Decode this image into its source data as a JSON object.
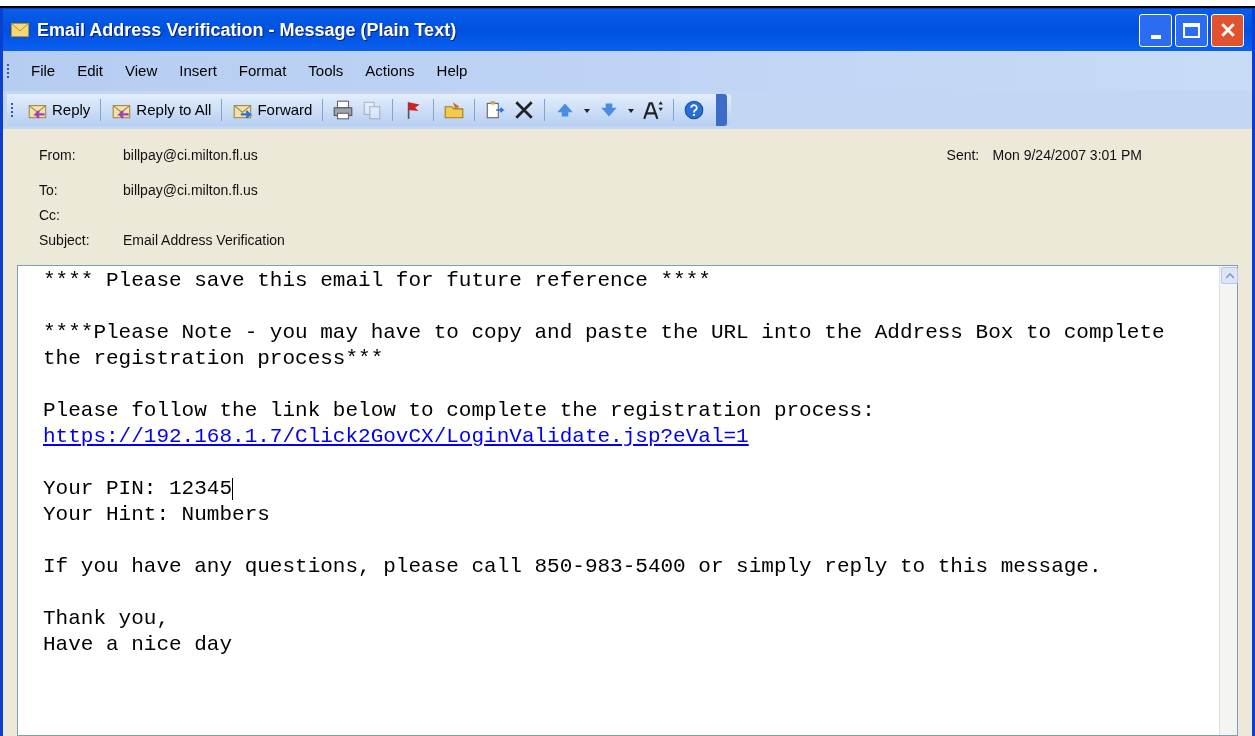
{
  "window": {
    "title": "Email Address Verification - Message (Plain Text)"
  },
  "menu": [
    "File",
    "Edit",
    "View",
    "Insert",
    "Format",
    "Tools",
    "Actions",
    "Help"
  ],
  "toolbar": [
    {
      "kind": "button",
      "label": "Reply"
    },
    {
      "kind": "separator"
    },
    {
      "kind": "button",
      "label": "Reply to All"
    },
    {
      "kind": "separator"
    },
    {
      "kind": "button",
      "label": "Forward"
    },
    {
      "kind": "separator"
    },
    {
      "kind": "icon",
      "disabled": false
    },
    {
      "kind": "icon",
      "disabled": true
    },
    {
      "kind": "separator"
    },
    {
      "kind": "icon",
      "disabled": false
    },
    {
      "kind": "separator"
    },
    {
      "kind": "icon",
      "disabled": false
    },
    {
      "kind": "separator"
    },
    {
      "kind": "icon",
      "disabled": false
    },
    {
      "kind": "icon",
      "disabled": false
    },
    {
      "kind": "separator"
    },
    {
      "kind": "icon",
      "disabled": false
    },
    {
      "kind": "icon",
      "disabled": false
    },
    {
      "kind": "icon",
      "disabled": false
    },
    {
      "kind": "icon",
      "disabled": false
    },
    {
      "kind": "icon",
      "disabled": false
    },
    {
      "kind": "separator"
    },
    {
      "kind": "icon",
      "disabled": false
    }
  ],
  "header": {
    "from_label": "From:",
    "from": "billpay@ci.milton.fl.us",
    "sent_label": "Sent:",
    "sent": "Mon 9/24/2007 3:01 PM",
    "fields": [
      {
        "label": "To:",
        "value": "billpay@ci.milton.fl.us"
      },
      {
        "label": "Cc:"
      },
      {
        "label": "Subject:",
        "value": "Email Address Verification"
      }
    ]
  },
  "body": [
    {
      "lines": [
        {
          "kind": "text",
          "text": "**** Please save this email for future reference ****",
          "cursor": false
        }
      ]
    },
    {
      "lines": [
        {
          "kind": "text",
          "text": "****Please Note - you may have to copy and paste the URL into the Address Box to complete",
          "cursor": false
        },
        {
          "kind": "text",
          "text": "the registration process***",
          "cursor": false
        }
      ]
    },
    {
      "lines": [
        {
          "kind": "text",
          "text": "Please follow the link below to complete the registration process:",
          "cursor": false
        },
        {
          "kind": "link",
          "text": "https://192.168.1.7/Click2GovCX/LoginValidate.jsp?eVal=1",
          "cursor": false
        }
      ]
    },
    {
      "lines": [
        {
          "kind": "text",
          "text": "Your PIN: 12345",
          "cursor": true
        },
        {
          "kind": "text",
          "text": "Your Hint: Numbers",
          "cursor": false
        }
      ]
    },
    {
      "lines": [
        {
          "kind": "text",
          "text": "If you have any questions, please call 850-983-5400 or simply reply to this message.",
          "cursor": false
        }
      ]
    },
    {
      "lines": [
        {
          "kind": "text",
          "text": "Thank you,",
          "cursor": false
        },
        {
          "kind": "text",
          "text": "Have a nice day",
          "cursor": false
        }
      ]
    }
  ]
}
